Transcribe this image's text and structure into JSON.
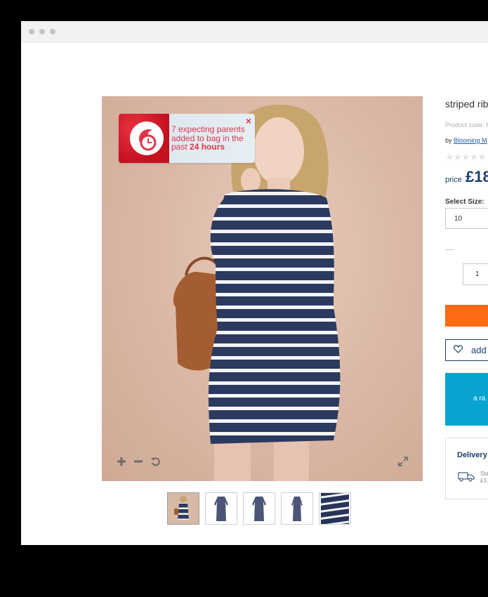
{
  "social_proof": {
    "line1": "7 expecting parents",
    "line2": "added to bag in the",
    "line3_prefix": "past ",
    "line3_bold": "24 hours",
    "close": "×"
  },
  "product": {
    "title": "striped rib",
    "code_label": "Product code: F",
    "by_prefix": "by ",
    "brand": "Blooming M",
    "stars": "★★★★★",
    "price_label": "price",
    "price": "£18",
    "size_label": "Select Size:",
    "size_value": "10",
    "qty_value": "1",
    "wishlist_label": "add",
    "promo_text": "a ra",
    "delivery_heading": "Delivery",
    "delivery_line1": "Sta",
    "delivery_line2": "£3."
  },
  "colors": {
    "accent_orange": "#ff6a13",
    "brand_navy": "#1b3d6e",
    "promo_blue": "#09a3cf",
    "alert_red": "#e0344a"
  },
  "icons": [
    "zoom-in-icon",
    "zoom-out-icon",
    "reset-icon",
    "expand-icon",
    "heart-icon",
    "van-icon",
    "close-icon"
  ]
}
